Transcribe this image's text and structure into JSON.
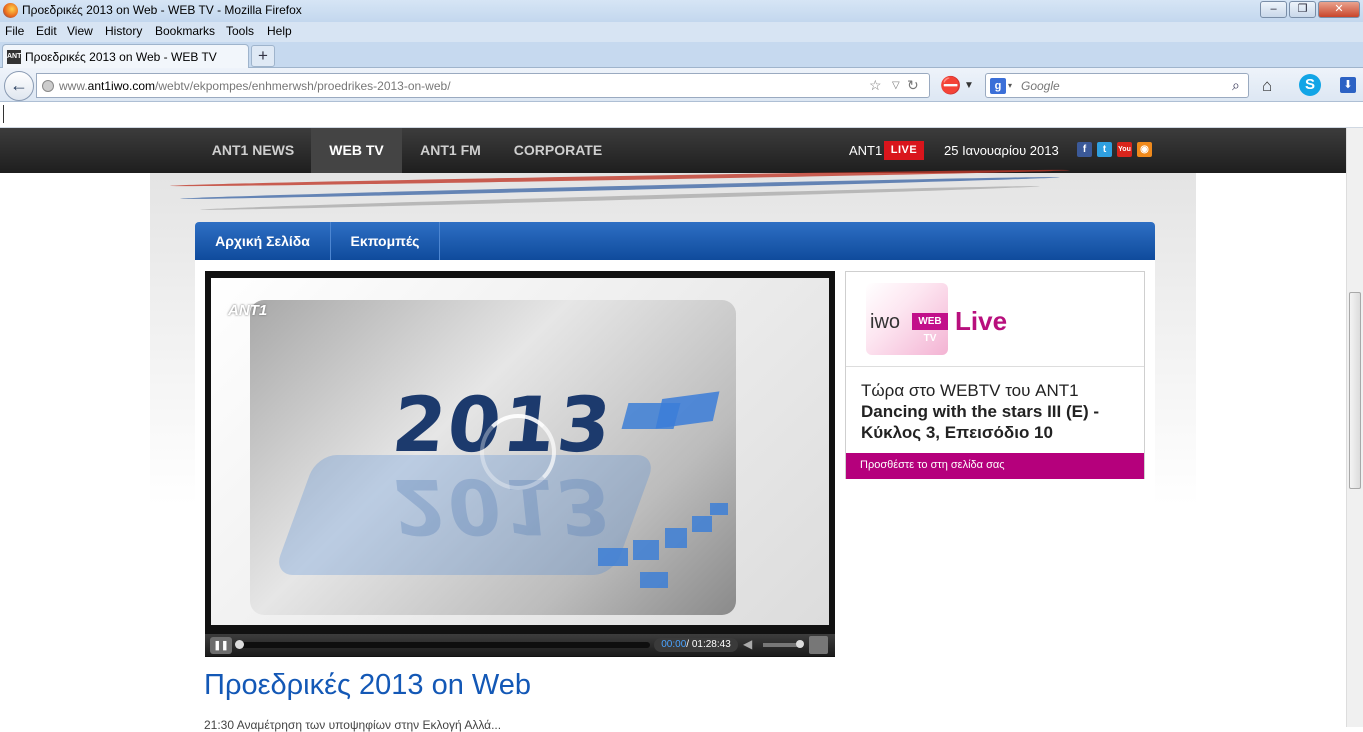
{
  "window": {
    "title": "Προεδρικές 2013 on Web - WEB TV - Mozilla Firefox",
    "controls": {
      "minimize": "–",
      "restore": "❐",
      "close": "✕"
    }
  },
  "menubar": [
    "File",
    "Edit",
    "View",
    "History",
    "Bookmarks",
    "Tools",
    "Help"
  ],
  "tabs": [
    {
      "label": "Προεδρικές 2013 on Web - WEB TV",
      "icon": "ant1-favicon"
    }
  ],
  "new_tab": "+",
  "address_bar": {
    "url_prefix": "www.",
    "url_domain": "ant1iwo.com",
    "url_path": "/webtv/ekpompes/enhmerwsh/proedrikes-2013-on-web/"
  },
  "search": {
    "placeholder": "Google",
    "engine_icon": "google-icon"
  },
  "site_nav": {
    "items": [
      "ANT1 NEWS",
      "WEB TV",
      "ANT1 FM",
      "CORPORATE"
    ],
    "active": "WEB TV",
    "live_channel": "ANT1",
    "live_badge": "LIVE",
    "date": "25 Ιανουαρίου 2013",
    "social": [
      {
        "name": "facebook-icon",
        "glyph": "f",
        "color": "#3b5998"
      },
      {
        "name": "twitter-icon",
        "glyph": "t",
        "color": "#2fa0e0"
      },
      {
        "name": "youtube-icon",
        "glyph": "You",
        "color": "#d9251c"
      },
      {
        "name": "rss-icon",
        "glyph": "◉",
        "color": "#f08a1c"
      }
    ]
  },
  "sub_nav": [
    "Αρχική Σελίδα",
    "Εκπομπές"
  ],
  "player": {
    "logo": "ANT1",
    "year": "2013",
    "time_current": "00:00",
    "time_total": "01:28:43",
    "progress": 0
  },
  "widget": {
    "brand": "iwo",
    "brand_tag": "WEB TV",
    "live": "Live",
    "now_label": "Τώρα στο WEBTV του ANT1",
    "show": "Dancing with the stars III (E) - Κύκλος 3, Επεισόδιο 10",
    "add_link": "Προσθέστε το στη σελίδα σας"
  },
  "page": {
    "title": "Προεδρικές 2013 on Web",
    "description": "21:30 Αναμέτρηση των υποψηφίων στην Εκλογή Αλλά..."
  },
  "colors": {
    "accent_blue": "#1358b6",
    "live_red": "#d9151c",
    "magenta": "#b5007c"
  }
}
